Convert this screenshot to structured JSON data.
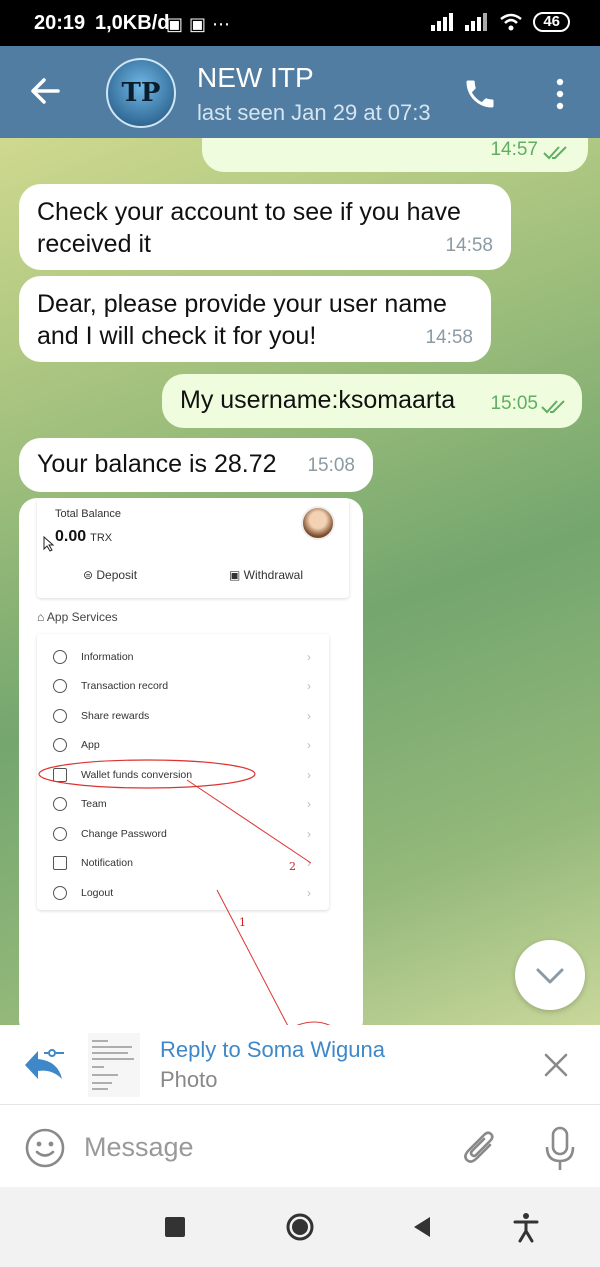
{
  "status_bar": {
    "time": "20:19",
    "speed": "1,0KB/d",
    "battery": "46"
  },
  "header": {
    "title": "NEW ITP",
    "subtitle": "last seen Jan 29 at 07:3",
    "avatar_text": "TP"
  },
  "messages": [
    {
      "dir": "out",
      "text": "",
      "time": "14:57"
    },
    {
      "dir": "in",
      "text": "Check your account to see if you have received it",
      "time": "14:58"
    },
    {
      "dir": "in",
      "text": "Dear, please provide your user name and I will check it for you!",
      "time": "14:58"
    },
    {
      "dir": "out",
      "text": "My username:ksomaarta",
      "time": "15:05"
    },
    {
      "dir": "in",
      "text": "Your balance is 28.72",
      "time": "15:08"
    }
  ],
  "photo": {
    "balance_label": "Total Balance",
    "balance_value": "0.00",
    "balance_unit": "TRX",
    "deposit": "Deposit",
    "withdrawal": "Withdrawal",
    "services_title": "App Services",
    "services": [
      "Information",
      "Transaction record",
      "Share rewards",
      "App",
      "Wallet funds conversion",
      "Team",
      "Change Password",
      "Notification",
      "Logout"
    ],
    "annotation_1": "1",
    "annotation_2": "2"
  },
  "reply": {
    "title": "Reply to Soma Wiguna",
    "subtitle": "Photo"
  },
  "input": {
    "placeholder": "Message"
  },
  "colors": {
    "header": "#517da2",
    "accent": "#3e88c9",
    "outgoing": "#effdde",
    "check": "#5fae62"
  }
}
